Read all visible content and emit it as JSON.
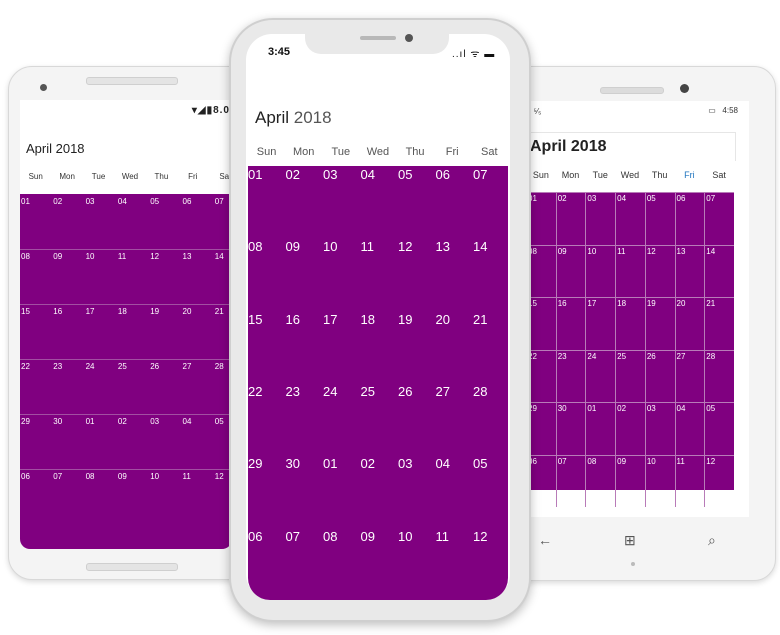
{
  "android": {
    "status_icons": "▾◢▮8.0",
    "month_title": "April 2018",
    "day_names": [
      "Sun",
      "Mon",
      "Tue",
      "Wed",
      "Thu",
      "Fri",
      "Sa"
    ],
    "weeks": [
      [
        "01",
        "02",
        "03",
        "04",
        "05",
        "06",
        "07"
      ],
      [
        "08",
        "09",
        "10",
        "11",
        "12",
        "13",
        "14"
      ],
      [
        "15",
        "16",
        "17",
        "18",
        "19",
        "20",
        "21"
      ],
      [
        "22",
        "23",
        "24",
        "25",
        "26",
        "27",
        "28"
      ],
      [
        "29",
        "30",
        "01",
        "02",
        "03",
        "04",
        "05"
      ],
      [
        "06",
        "07",
        "08",
        "09",
        "10",
        "11",
        "12"
      ]
    ]
  },
  "iphone": {
    "time": "3:45",
    "status_icons": "..ıl ᯤ ▬",
    "month_name": "April",
    "year": "2018",
    "day_names": [
      "Sun",
      "Mon",
      "Tue",
      "Wed",
      "Thu",
      "Fri",
      "Sat"
    ],
    "weeks": [
      [
        "01",
        "02",
        "03",
        "04",
        "05",
        "06",
        "07"
      ],
      [
        "08",
        "09",
        "10",
        "11",
        "12",
        "13",
        "14"
      ],
      [
        "15",
        "16",
        "17",
        "18",
        "19",
        "20",
        "21"
      ],
      [
        "22",
        "23",
        "24",
        "25",
        "26",
        "27",
        "28"
      ],
      [
        "29",
        "30",
        "01",
        "02",
        "03",
        "04",
        "05"
      ],
      [
        "06",
        "07",
        "08",
        "09",
        "10",
        "11",
        "12"
      ]
    ]
  },
  "windows": {
    "status_left": "ᯤ ⁵⁄₅",
    "battery_icon": "▭",
    "time": "4:58",
    "month_title": "April 2018",
    "day_names": [
      "Sun",
      "Mon",
      "Tue",
      "Wed",
      "Thu",
      "Fri",
      "Sat"
    ],
    "weeks": [
      [
        "01",
        "02",
        "03",
        "04",
        "05",
        "06",
        "07"
      ],
      [
        "08",
        "09",
        "10",
        "11",
        "12",
        "13",
        "14"
      ],
      [
        "15",
        "16",
        "17",
        "18",
        "19",
        "20",
        "21"
      ],
      [
        "22",
        "23",
        "24",
        "25",
        "26",
        "27",
        "28"
      ],
      [
        "29",
        "30",
        "01",
        "02",
        "03",
        "04",
        "05"
      ],
      [
        "06",
        "07",
        "08",
        "09",
        "10",
        "11",
        "12"
      ]
    ],
    "nav": {
      "back": "←",
      "home": "⊞",
      "search": "⌕"
    }
  },
  "colors": {
    "month_background": "#800080",
    "today_header": "#1e73be"
  }
}
